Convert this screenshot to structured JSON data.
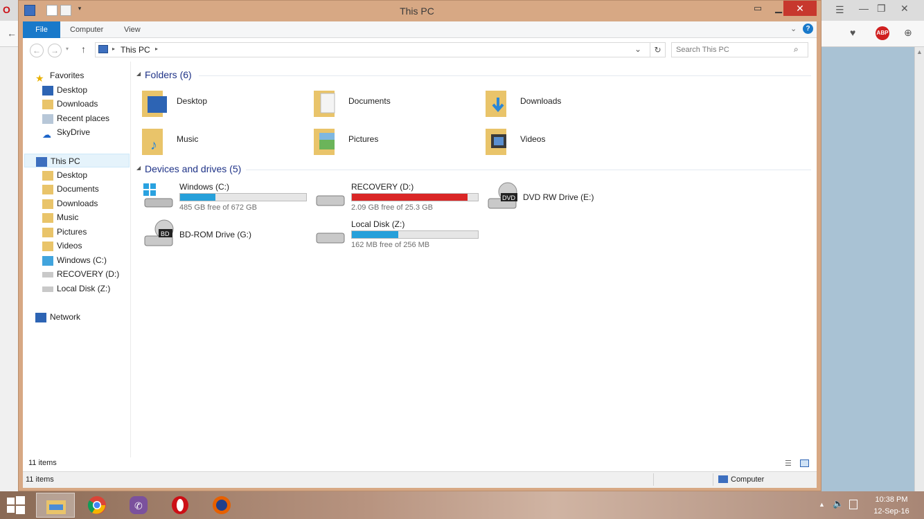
{
  "window": {
    "title": "This PC"
  },
  "ribbon": {
    "tabs": [
      "File",
      "Computer",
      "View"
    ]
  },
  "address": {
    "path": "This PC",
    "search_placeholder": "Search This PC"
  },
  "nav": {
    "favorites": {
      "label": "Favorites",
      "items": [
        "Desktop",
        "Downloads",
        "Recent places",
        "SkyDrive"
      ]
    },
    "thispc": {
      "label": "This PC",
      "items": [
        "Desktop",
        "Documents",
        "Downloads",
        "Music",
        "Pictures",
        "Videos",
        "Windows (C:)",
        "RECOVERY (D:)",
        "Local Disk (Z:)"
      ]
    },
    "network": {
      "label": "Network"
    }
  },
  "folders": {
    "header": "Folders (6)",
    "items": [
      "Desktop",
      "Documents",
      "Downloads",
      "Music",
      "Pictures",
      "Videos"
    ]
  },
  "drives": {
    "header": "Devices and drives (5)",
    "items": [
      {
        "name": "Windows (C:)",
        "free": "485 GB free of 672 GB",
        "used_fraction": 0.28,
        "color": "#26a0da"
      },
      {
        "name": "RECOVERY (D:)",
        "free": "2.09 GB free of 25.3 GB",
        "used_fraction": 0.92,
        "color": "#da2626"
      },
      {
        "name": "DVD RW Drive (E:)"
      },
      {
        "name": "BD-ROM Drive (G:)"
      },
      {
        "name": "Local Disk (Z:)",
        "free": "162 MB free of 256 MB",
        "used_fraction": 0.37,
        "color": "#26a0da"
      }
    ]
  },
  "status": {
    "inner": "11 items",
    "outer": "11 items",
    "zone": "Computer"
  },
  "taskbar": {
    "time": "10:38 PM",
    "date": "12-Sep-16"
  },
  "icons": {
    "dvd": "DVD",
    "bd": "BD"
  }
}
